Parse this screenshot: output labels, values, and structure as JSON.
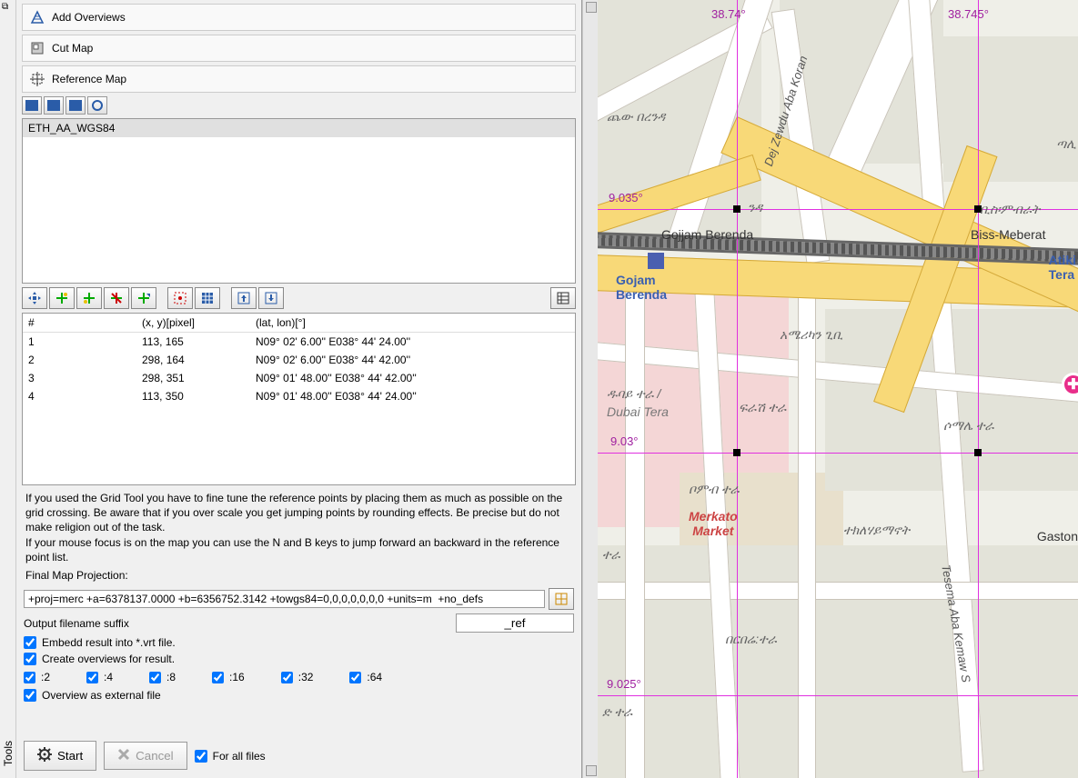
{
  "sidebar": {
    "tools_label": "Tools"
  },
  "actions": {
    "add_overviews": "Add Overviews",
    "cut_map": "Cut Map",
    "reference_map": "Reference Map"
  },
  "file_list": {
    "items": [
      "ETH_AA_WGS84"
    ]
  },
  "ref_table": {
    "headers": {
      "num": "#",
      "xy": "(x, y)[pixel]",
      "latlon": "(lat, lon)[°]"
    },
    "rows": [
      {
        "n": "1",
        "xy": "113, 165",
        "ll": "N09° 02' 6.00'' E038° 44' 24.00''"
      },
      {
        "n": "2",
        "xy": "298, 164",
        "ll": "N09° 02' 6.00'' E038° 44' 42.00''"
      },
      {
        "n": "3",
        "xy": "298, 351",
        "ll": "N09° 01' 48.00'' E038° 44' 42.00''"
      },
      {
        "n": "4",
        "xy": "113, 350",
        "ll": "N09° 01' 48.00'' E038° 44' 24.00''"
      }
    ]
  },
  "instructions": {
    "p1": "If you used the Grid Tool you have to fine tune the reference points by placing them as much as possible on the grid crossing. Be aware that if you over scale you get jumping points by rounding effects. Be precise but do not make religion out of the task.",
    "p2": "If your mouse focus is on the map you can use the N and B keys to jump forward an backward in the reference point list.",
    "proj_label": "Final Map Projection:"
  },
  "proj": {
    "value": "+proj=merc +a=6378137.0000 +b=6356752.3142 +towgs84=0,0,0,0,0,0,0 +units=m  +no_defs"
  },
  "suffix": {
    "label": "Output filename suffix",
    "value": "_ref"
  },
  "checks": {
    "embed": "Embedd result into *.vrt file.",
    "createov": "Create overviews for result.",
    "ov_ext": "Overview as external file",
    "for_all": "For all files"
  },
  "overview_levels": [
    ":2",
    ":4",
    ":8",
    ":16",
    ":32",
    ":64"
  ],
  "buttons": {
    "start": "Start",
    "cancel": "Cancel"
  },
  "map": {
    "grid_lon": [
      "38.74°",
      "38.745°"
    ],
    "grid_lat": [
      "9.035°",
      "9.03°",
      "9.025°"
    ],
    "labels": {
      "gojjam_berenda_road": "Gojjam Berenda",
      "gojam_berenda_area": "Gojam\nBerenda",
      "biss": "Biss-Meberat",
      "atik": "Atiki\nTera",
      "dubai": "Dubai Tera",
      "merkato": "Merkato\nMarket",
      "gaston": "Gaston",
      "dej_zewdu": "Dej Zewdu Aba Koran",
      "tesema": "Tesema Aba Kemaw S",
      "amh_chew": "ጨው በረንዳ",
      "amh_american": "አሜሪካን ጊቢ",
      "amh_dubai": "ዱባይ ተራ /",
      "amh_frash": "ፍራሽ ተራ",
      "amh_somale": "ሶማሌ ተራ",
      "amh_bomb": "ቦምብ ተራ",
      "amh_tekle": "ተክለሃይማኖት",
      "amh_berbere": "በርበሬ:ተራ",
      "amh_nd": "ንዳ",
      "amh_talyan": "ጣሊ",
      "amh_bis": "ቢስ፡ምብራት",
      "amh_d": "ድ ተራ",
      "amh_tera": "ተራ"
    }
  }
}
